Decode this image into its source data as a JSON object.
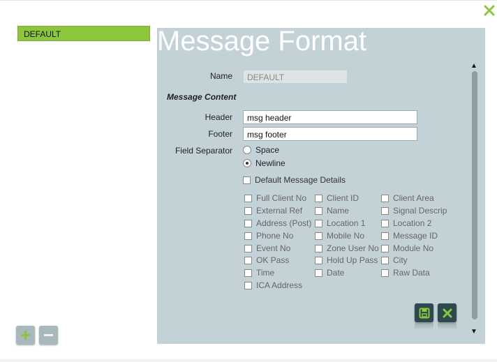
{
  "profiles": {
    "items": [
      "DEFAULT"
    ]
  },
  "form": {
    "title": "Message Format",
    "name_label": "Name",
    "name_value": "DEFAULT",
    "section_label": "Message Content",
    "header_label": "Header",
    "header_value": "msg header",
    "footer_label": "Footer",
    "footer_value": "msg footer",
    "separator_label": "Field Separator",
    "separator_options": [
      "Space",
      "Newline"
    ],
    "separator_selected": "Newline",
    "default_details_label": "Default Message Details",
    "fields": [
      [
        "Full Client No",
        "Client ID",
        "Client Area"
      ],
      [
        "External Ref",
        "Name",
        "Signal Descrip"
      ],
      [
        "Address (Post)",
        "Location 1",
        "Location 2"
      ],
      [
        "Phone No",
        "Mobile No",
        "Message ID"
      ],
      [
        "Event No",
        "Zone User No",
        "Module No"
      ],
      [
        "OK Pass",
        "Hold Up Pass",
        "City"
      ],
      [
        "Time",
        "Date",
        "Raw Data"
      ],
      [
        "ICA Address"
      ]
    ]
  },
  "icons": {
    "close": "close-icon",
    "add": "plus-icon",
    "remove": "minus-icon",
    "save": "save-icon",
    "cancel": "x-icon"
  },
  "colors": {
    "accent": "#8cc63f",
    "panel": "#c3d2d7",
    "action_button": "#2f4a4e"
  }
}
